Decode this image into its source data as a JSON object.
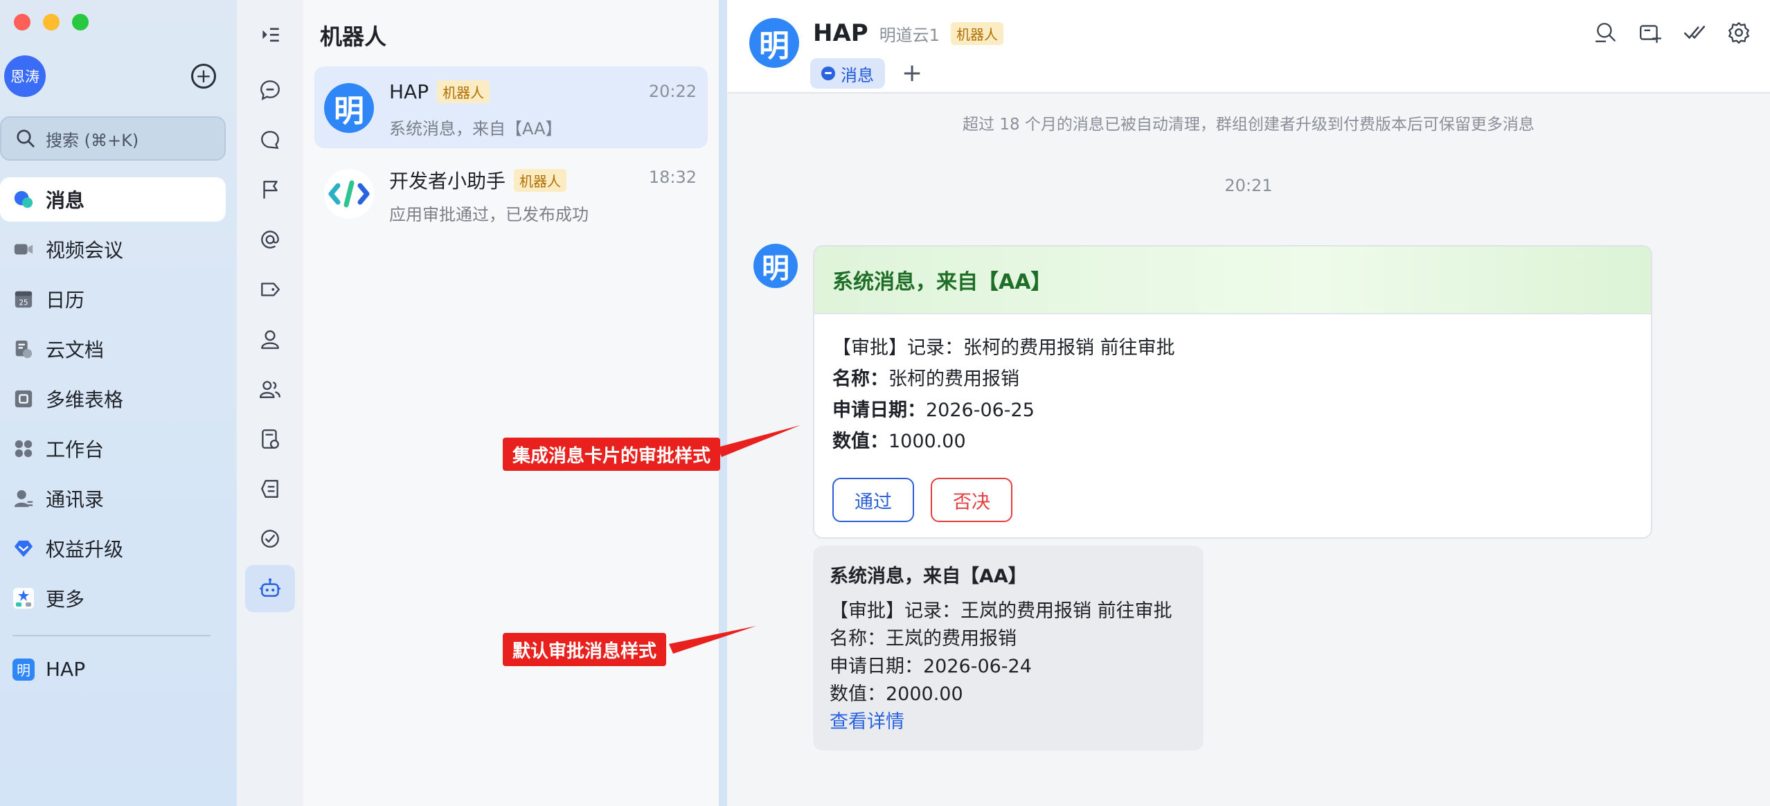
{
  "sidebar": {
    "user_avatar": "恩涛",
    "search_placeholder": "搜索 (⌘+K)",
    "items": [
      {
        "label": "消息",
        "icon": "chat-bubble-icon"
      },
      {
        "label": "视频会议",
        "icon": "video-camera-icon"
      },
      {
        "label": "日历",
        "icon": "calendar-icon",
        "icon_text": "25"
      },
      {
        "label": "云文档",
        "icon": "cloud-doc-icon"
      },
      {
        "label": "多维表格",
        "icon": "grid-table-icon"
      },
      {
        "label": "工作台",
        "icon": "apps-icon"
      },
      {
        "label": "通讯录",
        "icon": "contacts-icon"
      },
      {
        "label": "权益升级",
        "icon": "diamond-icon"
      },
      {
        "label": "更多",
        "icon": "more-apps-icon"
      }
    ],
    "app_item": {
      "label": "HAP",
      "badge": "明"
    }
  },
  "conversation_list": {
    "title": "机器人",
    "items": [
      {
        "name": "HAP",
        "tag": "机器人",
        "time": "20:22",
        "preview": "系统消息，来自【AA】",
        "avatar": "明"
      },
      {
        "name": "开发者小助手",
        "tag": "机器人",
        "time": "18:32",
        "preview": "应用审批通过，已发布成功",
        "avatar": ""
      }
    ]
  },
  "chat": {
    "name": "HAP",
    "subtitle": "明道云1",
    "tag": "机器人",
    "avatar": "明",
    "tab_label": "消息",
    "tab_add": "+",
    "notice": "超过 18 个月的消息已被自动清理，群组创建者升级到付费版本后可保留更多消息",
    "timestamp": "20:21",
    "card": {
      "title": "系统消息，来自【AA】",
      "line1": "【审批】记录：张柯的费用报销 前往审批",
      "name_label": "名称：",
      "name_value": "张柯的费用报销",
      "date_label": "申请日期：",
      "date_value": "2026-06-25",
      "amount_label": "数值：",
      "amount_value": "1000.00",
      "approve_label": "通过",
      "reject_label": "否决"
    },
    "plain": {
      "title": "系统消息，来自【AA】",
      "line1": "【审批】记录：王岚的费用报销 前往审批",
      "line2": "名称：王岚的费用报销",
      "line3": "申请日期：2026-06-24",
      "line4": "数值：2000.00",
      "link": "查看详情"
    }
  },
  "annotations": {
    "card_style": "集成消息卡片的审批样式",
    "default_style": "默认审批消息样式"
  },
  "colors": {
    "accent": "#2a5fd6",
    "reject": "#e33d3d",
    "annotation": "#e8211e",
    "card_header": "#dff4da"
  }
}
